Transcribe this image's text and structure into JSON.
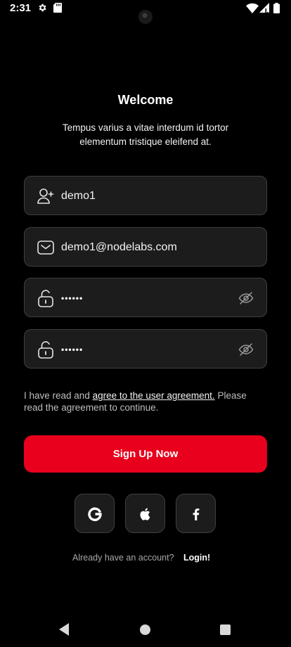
{
  "status_bar": {
    "time": "2:31",
    "icons": [
      "settings-gear-icon",
      "sd-card-icon",
      "wifi-icon",
      "signal-icon",
      "battery-icon"
    ]
  },
  "header": {
    "title": "Welcome",
    "subtitle": "Tempus varius a vitae interdum id tortor elementum tristique eleifend at."
  },
  "form": {
    "username": {
      "value": "demo1",
      "icon": "user-add-icon"
    },
    "email": {
      "value": "demo1@nodelabs.com",
      "icon": "mail-icon"
    },
    "password": {
      "value": "••••••",
      "icon": "unlock-icon",
      "toggle_icon": "eye-off-icon"
    },
    "confirm_password": {
      "value": "••••••",
      "icon": "unlock-icon",
      "toggle_icon": "eye-off-icon"
    }
  },
  "agreement": {
    "prefix": "I have read and ",
    "link": "agree to the user agreement.",
    "suffix": " Please read the agreement to continue."
  },
  "signup_button": {
    "label": "Sign Up Now"
  },
  "social": [
    {
      "name": "google",
      "icon": "google-icon"
    },
    {
      "name": "apple",
      "icon": "apple-icon"
    },
    {
      "name": "facebook",
      "icon": "facebook-icon"
    }
  ],
  "footer": {
    "prompt": "Already have an account?",
    "login_label": "Login!"
  },
  "nav_bar": {
    "icons": [
      "back-icon",
      "home-icon",
      "recents-icon"
    ]
  },
  "colors": {
    "background": "#000000",
    "field_bg": "#1c1c1c",
    "field_border": "#3f3f3f",
    "accent": "#e8001c"
  }
}
